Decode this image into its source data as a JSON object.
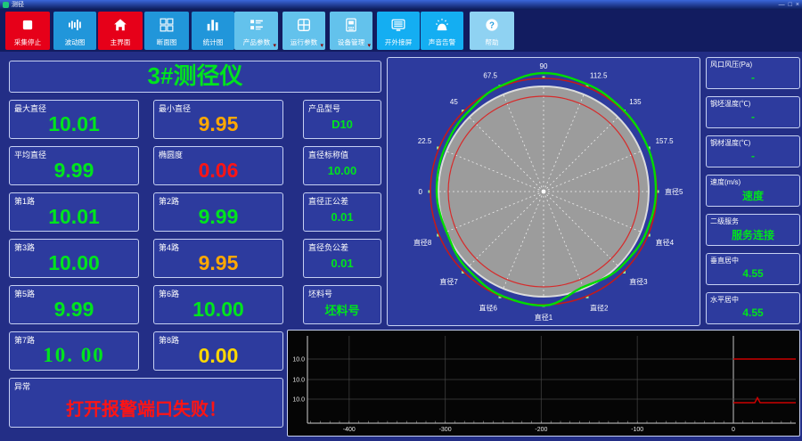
{
  "window": {
    "title": "测径",
    "controls": [
      "—",
      "□",
      "×"
    ]
  },
  "toolbar": {
    "buttons": [
      {
        "label": "采集停止",
        "icon": "stop",
        "style": "red",
        "dropdown": false
      },
      {
        "label": "波动图",
        "icon": "wave",
        "style": "blue",
        "dropdown": false
      },
      {
        "label": "主界面",
        "icon": "home",
        "style": "red",
        "dropdown": false
      },
      {
        "label": "断面图",
        "icon": "section",
        "style": "blue",
        "dropdown": false
      },
      {
        "label": "统计图",
        "icon": "stats",
        "style": "blue",
        "dropdown": false
      },
      {
        "label": "产品参数",
        "icon": "list",
        "style": "light",
        "dropdown": true
      },
      {
        "label": "运行参数",
        "icon": "grid",
        "style": "light",
        "dropdown": true
      },
      {
        "label": "设备管理",
        "icon": "device",
        "style": "light",
        "dropdown": true
      },
      {
        "label": "开外接屏",
        "icon": "monitor",
        "style": "bright",
        "dropdown": false
      },
      {
        "label": "声音告警",
        "icon": "alarm",
        "style": "bright",
        "dropdown": false
      },
      {
        "label": "帮助",
        "icon": "help",
        "style": "pale",
        "dropdown": false
      }
    ]
  },
  "left": {
    "title": "3#测径仪",
    "rows": [
      [
        {
          "label": "最大直径",
          "value": "10.01",
          "color": "#00e41e"
        },
        {
          "label": "最小直径",
          "value": "9.95",
          "color": "#ffa800"
        },
        {
          "label": "产品型号",
          "value": "D10",
          "color": "#00e41e"
        }
      ],
      [
        {
          "label": "平均直径",
          "value": "9.99",
          "color": "#00e41e"
        },
        {
          "label": "椭圆度",
          "value": "0.06",
          "color": "#ff1414"
        },
        {
          "label": "直径标称值",
          "value": "10.00",
          "color": "#00e41e"
        }
      ],
      [
        {
          "label": "第1路",
          "value": "10.01",
          "color": "#00e41e"
        },
        {
          "label": "第2路",
          "value": "9.99",
          "color": "#00e41e"
        },
        {
          "label": "直径正公差",
          "value": "0.01",
          "color": "#00e41e"
        }
      ],
      [
        {
          "label": "第3路",
          "value": "10.00",
          "color": "#00e41e"
        },
        {
          "label": "第4路",
          "value": "9.95",
          "color": "#ffa800"
        },
        {
          "label": "直径负公差",
          "value": "0.01",
          "color": "#00e41e"
        }
      ],
      [
        {
          "label": "第5路",
          "value": "9.99",
          "color": "#00e41e"
        },
        {
          "label": "第6路",
          "value": "10.00",
          "color": "#00e41e"
        },
        {
          "label": "坯料号",
          "value": "坯料号",
          "color": "#00e41e"
        }
      ],
      [
        {
          "label": "第7路",
          "value": "10. 00",
          "color": "#00e41e",
          "serif": true
        },
        {
          "label": "第8路",
          "value": "0.00",
          "color": "#ffd800"
        }
      ]
    ],
    "alarm": {
      "label": "异常",
      "value": "打开报警端口失败！",
      "color": "#ff1414"
    }
  },
  "right_panels": [
    {
      "label": "风口风压(Pa)",
      "value": "-"
    },
    {
      "label": "钢坯温度(℃)",
      "value": "-"
    },
    {
      "label": "钢材温度(℃)",
      "value": "-"
    },
    {
      "label": "速度(m/s)",
      "value": "速度"
    },
    {
      "label": "二级服务",
      "value": "服务连接"
    },
    {
      "label": "垂直居中",
      "value": "4.55"
    },
    {
      "label": "水平居中",
      "value": "4.55"
    }
  ],
  "polar": {
    "spoke_labels": [
      "直径5",
      "157.5",
      "135",
      "112.5",
      "90",
      "67.5",
      "45",
      "22.5",
      "0",
      "直径8",
      "直径7",
      "直径6",
      "直径1",
      "直径2",
      "直径3",
      "直径4"
    ],
    "profile_radii": [
      126,
      127,
      128,
      130,
      133,
      128,
      123,
      121,
      120,
      118,
      122,
      126,
      128,
      116,
      121,
      124
    ],
    "radii": {
      "disc": 118,
      "outer": 127,
      "inner": 107
    },
    "colors": {
      "disc": "#9c9c9c",
      "rim": "#dcdcdc",
      "outer_ring": "#c41a1a",
      "inner_ring": "#d62b2b",
      "profile": "#00dc00",
      "spoke": "#eeeeee",
      "marker": "#9cf59c",
      "label": "#ffffff"
    }
  },
  "bottom_chart": {
    "type": "line",
    "y_labels": [
      "10.0",
      "10.0",
      "10.0"
    ],
    "x_ticks": [
      -400,
      -300,
      -200,
      -100,
      0
    ],
    "x_tick_labels": [
      "-400",
      "-300",
      "-200",
      "-100",
      "0"
    ],
    "red_lines": [
      {
        "row": 0,
        "dy": 0,
        "spike": false
      },
      {
        "row": 2,
        "dy": 4,
        "spike": true
      }
    ],
    "line_color": "#cc0000",
    "axis_color": "#cfcfcf",
    "grid_color": "#454545",
    "zero_line_color": "#c4c4c4"
  }
}
